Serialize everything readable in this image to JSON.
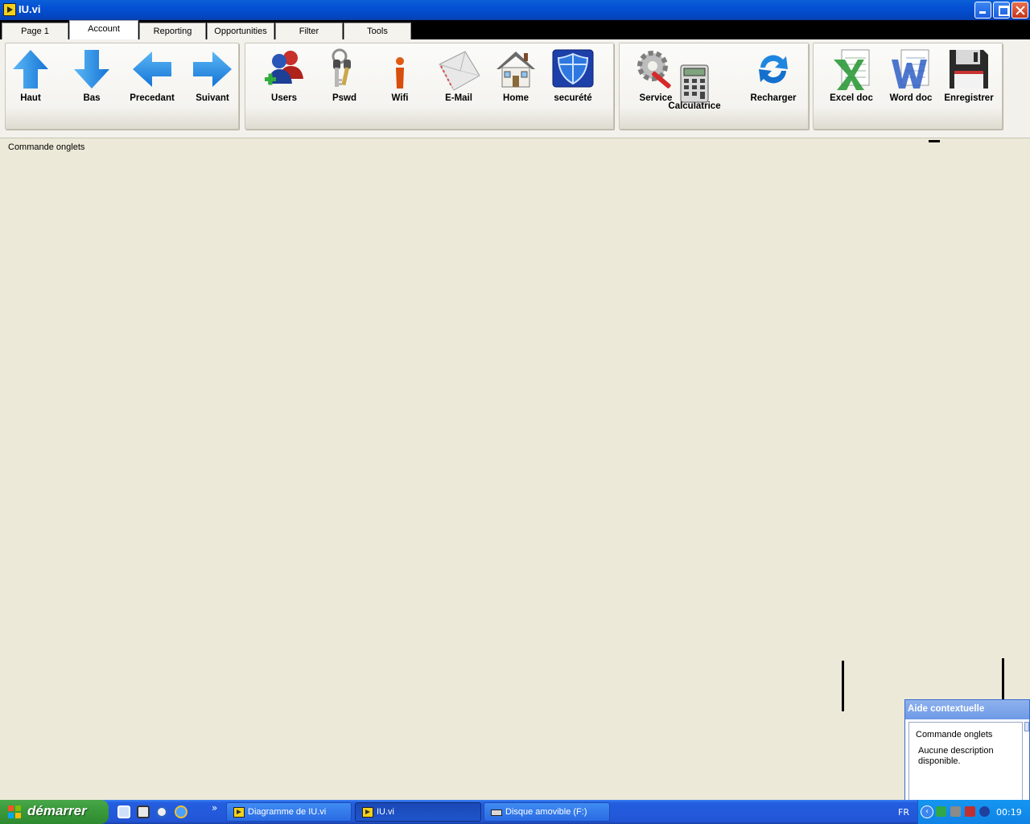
{
  "window": {
    "title": "IU.vi"
  },
  "tabs": [
    {
      "label": "Page 1",
      "active": false
    },
    {
      "label": "Account",
      "active": true
    },
    {
      "label": "Reporting",
      "active": false
    },
    {
      "label": "Opportunities",
      "active": false
    },
    {
      "label": "Filter",
      "active": false
    },
    {
      "label": "Tools",
      "active": false
    }
  ],
  "ribbon": {
    "navigation": [
      {
        "label": "Haut",
        "icon": "arrow-up-icon"
      },
      {
        "label": "Bas",
        "icon": "arrow-down-icon"
      },
      {
        "label": "Precedant",
        "icon": "arrow-left-icon"
      },
      {
        "label": "Suivant",
        "icon": "arrow-right-icon"
      }
    ],
    "account": [
      {
        "label": "Users",
        "icon": "users-icon"
      },
      {
        "label": "Pswd",
        "icon": "keys-icon"
      },
      {
        "label": "Wifi",
        "icon": "info-icon"
      },
      {
        "label": "E-Mail",
        "icon": "envelope-icon"
      },
      {
        "label": "Home",
        "icon": "house-icon"
      },
      {
        "label": "securété",
        "icon": "shield-icon"
      }
    ],
    "tools": [
      {
        "label": "Service",
        "icon": "gear-tools-icon"
      },
      {
        "label": "Calculatrice",
        "icon": "calculator-icon"
      },
      {
        "label": "Recharger",
        "icon": "refresh-icon"
      }
    ],
    "documents": [
      {
        "label": "Excel doc",
        "icon": "excel-doc-icon"
      },
      {
        "label": "Word doc",
        "icon": "word-doc-icon"
      },
      {
        "label": "Enregistrer",
        "icon": "floppy-disk-icon"
      }
    ]
  },
  "content": {
    "caption": "Commande onglets"
  },
  "help": {
    "title": "Aide contextuelle",
    "heading": "Commande onglets",
    "description": "Aucune description disponible."
  },
  "taskbar": {
    "start_label": "démarrer",
    "tasks": [
      {
        "label": "Diagramme de IU.vi",
        "active": false
      },
      {
        "label": "IU.vi",
        "active": true
      },
      {
        "label": "Disque amovible (F:)",
        "active": false
      }
    ],
    "language": "FR",
    "clock": "00:19"
  },
  "colors": {
    "titlebar": "#0450d4",
    "accent_blue": "#1f86e0",
    "taskbar": "#245ee0",
    "start_green": "#3b9b3c",
    "background": "#ECE9D8"
  }
}
